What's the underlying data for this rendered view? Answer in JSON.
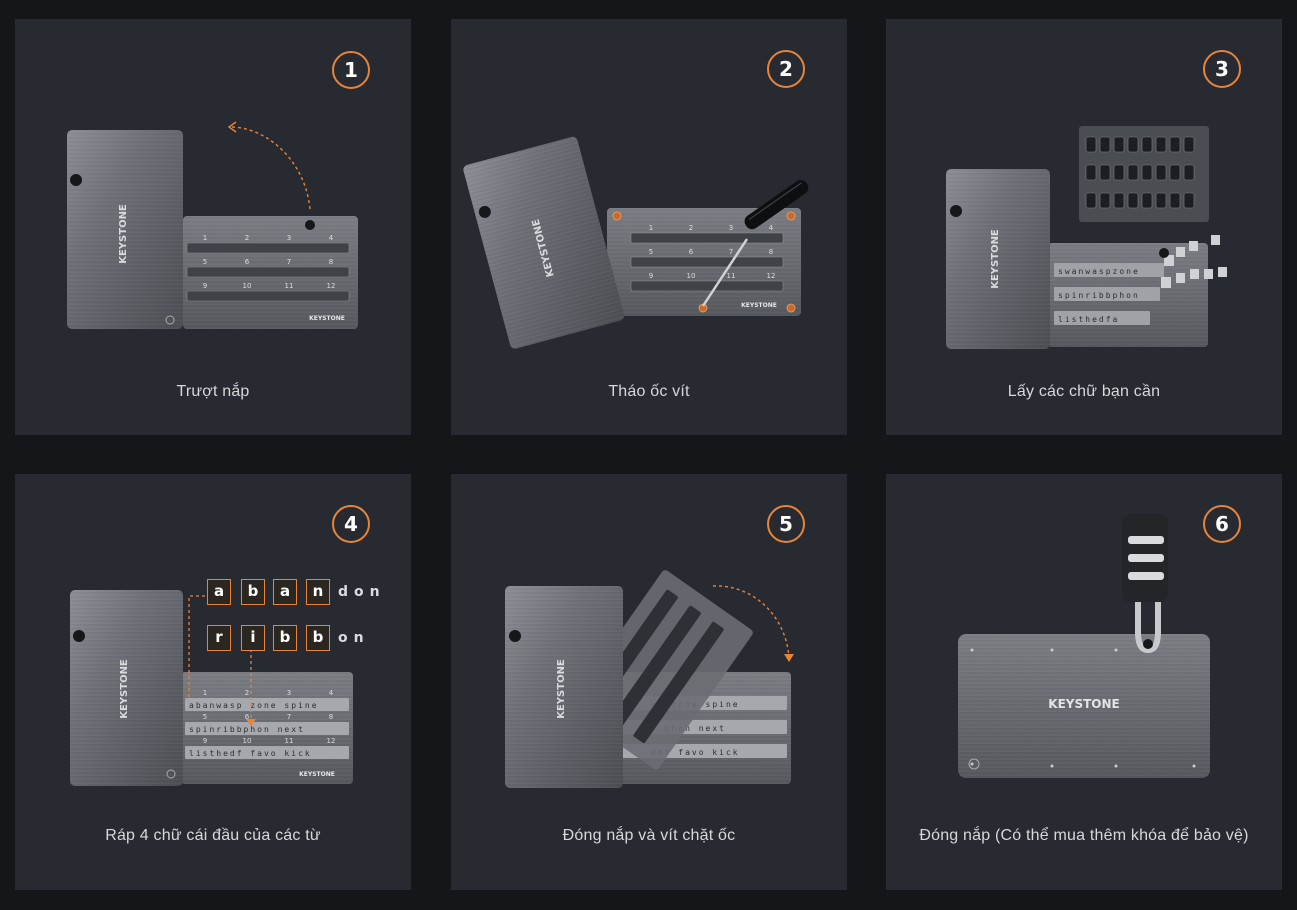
{
  "accent_color": "#e8843a",
  "brand": "KEYSTONE",
  "steps": [
    {
      "number": "1",
      "caption": "Trượt nắp"
    },
    {
      "number": "2",
      "caption": "Tháo ốc vít"
    },
    {
      "number": "3",
      "caption": "Lấy các chữ bạn cần"
    },
    {
      "number": "4",
      "caption": "Ráp 4 chữ cái đầu của các từ"
    },
    {
      "number": "5",
      "caption": "Đóng nắp và vít chặt ốc"
    },
    {
      "number": "6",
      "caption": "Đóng nắp (Có thể mua thêm khóa để bảo vệ)"
    }
  ],
  "step4_words": [
    {
      "letters": [
        "a",
        "b",
        "a",
        "n"
      ],
      "rest": "don"
    },
    {
      "letters": [
        "r",
        "i",
        "b",
        "b"
      ],
      "rest": "on"
    }
  ],
  "slot_numbers": [
    "1",
    "2",
    "3",
    "4",
    "5",
    "6",
    "7",
    "8",
    "9",
    "10",
    "11",
    "12"
  ]
}
